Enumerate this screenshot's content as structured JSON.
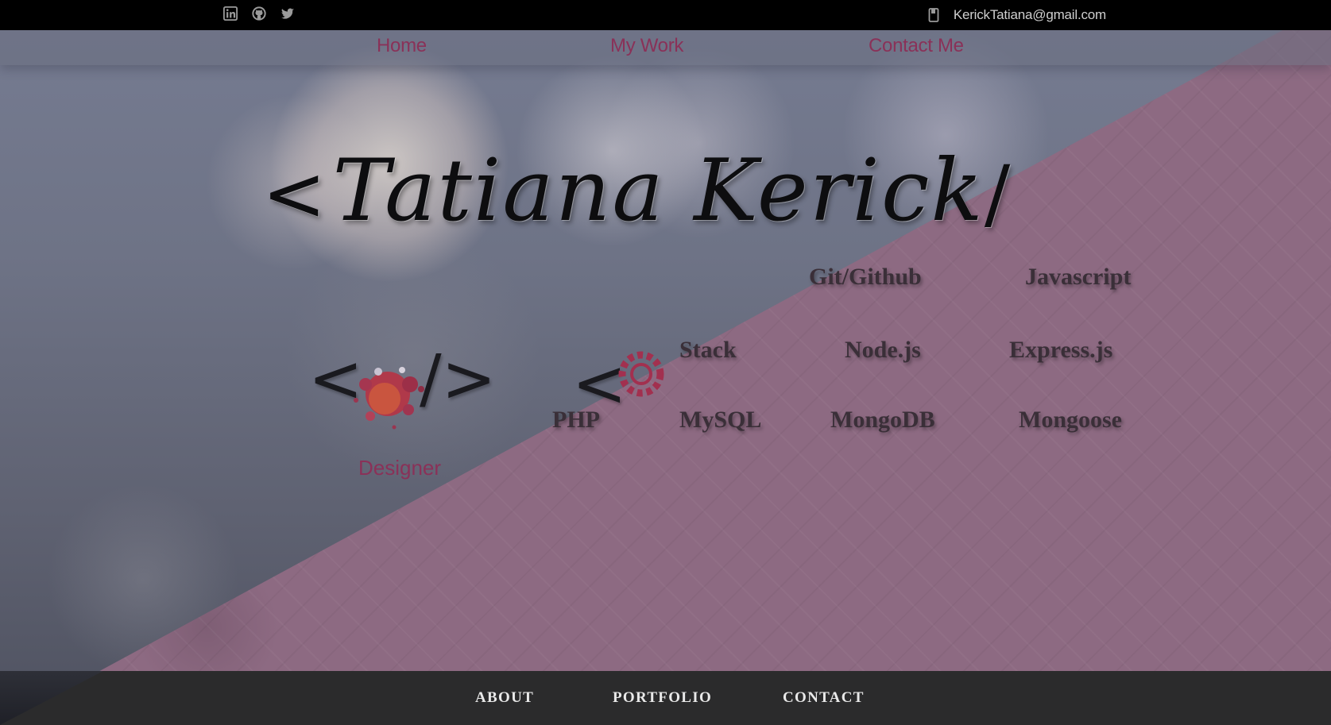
{
  "topbar": {
    "social": [
      {
        "name": "linkedin-icon"
      },
      {
        "name": "github-icon"
      },
      {
        "name": "twitter-icon"
      }
    ],
    "email_icon": "phone-icon",
    "email": "KerickTatiana@gmail.com"
  },
  "nav": {
    "items": [
      {
        "label": "Home"
      },
      {
        "label": "My Work"
      },
      {
        "label": "Contact Me"
      }
    ]
  },
  "hero": {
    "title": "Tatiana Kerick",
    "title_open": "<",
    "title_close": "/"
  },
  "roles": {
    "designer": {
      "bracket_open": "<",
      "bracket_close": "/>",
      "label": "Designer",
      "icon": "paint-splatter-icon"
    },
    "developer": {
      "bracket_open": "<",
      "icon": "gear-icon"
    }
  },
  "skills": {
    "row1": [
      "Git/Github",
      "Javascript"
    ],
    "row2": [
      "Stack",
      "Node.js",
      "Express.js"
    ],
    "row3": [
      "PHP",
      "MySQL",
      "MongoDB",
      "Mongoose"
    ]
  },
  "footer": {
    "items": [
      {
        "label": "ABOUT"
      },
      {
        "label": "PORTFOLIO"
      },
      {
        "label": "CONTACT"
      }
    ]
  },
  "colors": {
    "accent": "#8a3158",
    "pink_overlay": "#8d6a82",
    "footer_bg": "#2b2b2c",
    "topbar_bg": "#000000"
  }
}
